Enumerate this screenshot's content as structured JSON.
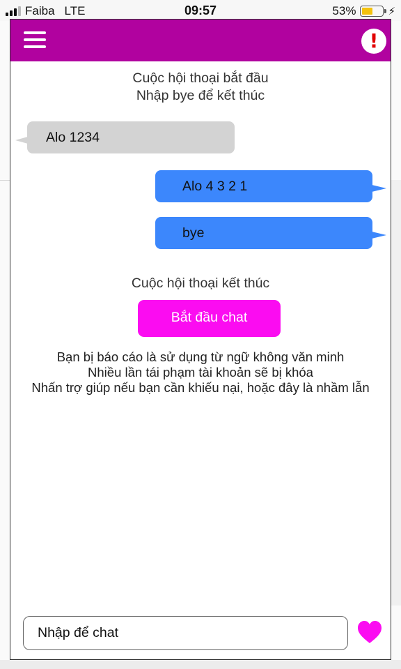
{
  "status_bar": {
    "carrier": "Faiba",
    "network": "LTE",
    "time": "09:57",
    "battery_percent": "53%",
    "battery_level": 0.53
  },
  "header": {
    "menu_icon": "hamburger-menu-icon",
    "report_icon": "exclamation-icon",
    "report_label": "!",
    "color": "#b1029f"
  },
  "chat": {
    "start_line_1": "Cuộc hội thoại bắt đầu",
    "start_line_2": "Nhập bye để kết thúc",
    "messages": [
      {
        "from": "stranger",
        "text": "Alo 1234"
      },
      {
        "from": "me",
        "text": "Alo 4 3 2 1"
      },
      {
        "from": "me",
        "text": "bye"
      }
    ],
    "end_text": "Cuộc hội thoại kết thúc",
    "start_button": "Bắt đầu chat",
    "notice": [
      "Bạn bị báo cáo là sử dụng từ ngữ không văn minh",
      "Nhiều lần tái phạm tài khoản sẽ bị khóa",
      "Nhấn trợ giúp nếu bạn cần khiếu nại, hoặc đây là nhầm lẫn"
    ]
  },
  "composer": {
    "placeholder": "Nhập để chat",
    "value": "",
    "send_icon": "heart-icon"
  },
  "colors": {
    "incoming_bubble": "#d3d3d3",
    "outgoing_bubble": "#3c87fc",
    "accent": "#fb0cf1",
    "heart": "#fb0cf1"
  }
}
